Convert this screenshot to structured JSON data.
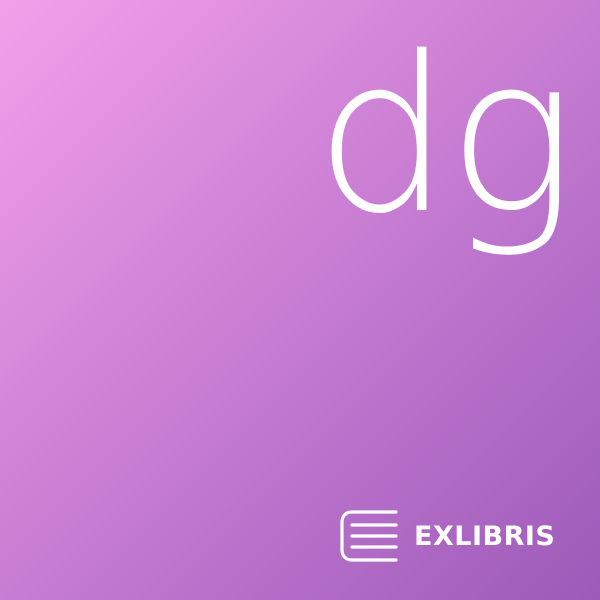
{
  "tile": {
    "monogram": "dg",
    "brand_name": "EXLIBRIS",
    "brand_icon": "book-stack-icon",
    "colors": {
      "gradient_start": "#f3a0ea",
      "gradient_end": "#9d5ab8",
      "text": "#ffffff"
    }
  }
}
